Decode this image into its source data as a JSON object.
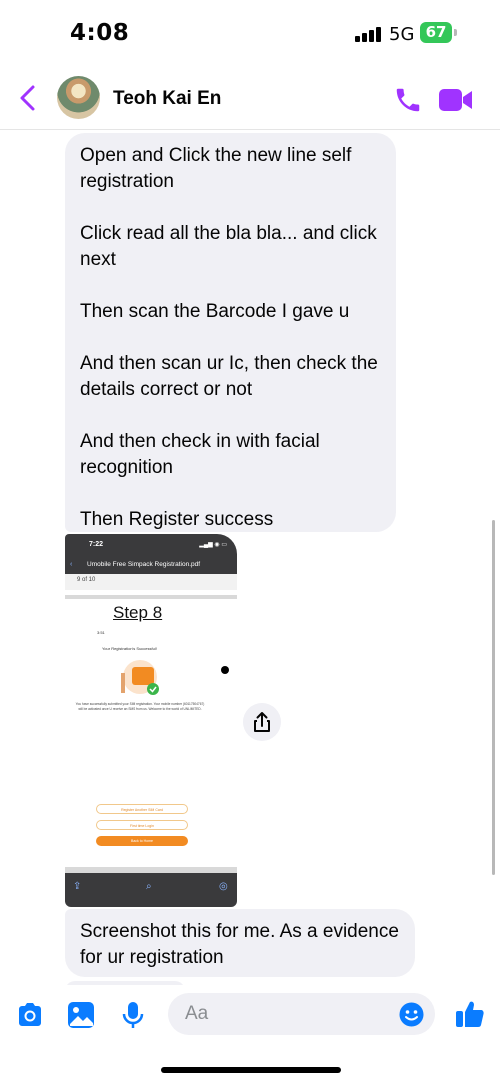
{
  "status_bar": {
    "time": "4:08",
    "network": "5G",
    "battery": "67"
  },
  "header": {
    "contact_name": "Teoh Kai En",
    "accent_color": "#a033ff",
    "icons": [
      "back-chevron-icon",
      "phone-icon",
      "video-camera-icon"
    ]
  },
  "messages": {
    "bubble_1": "Open and Click the new line self registration\n\nClick read all the bla bla... and click next\n\nThen scan the Barcode I gave u\n\nAnd then scan ur Ic, then check the details correct or not\n\nAnd then check in with facial recognition\n\nThen Register success",
    "bubble_2": "Screenshot this for me. As a evidence for ur registration"
  },
  "shared_image": {
    "time": "7:22",
    "file_title": "Umobile Free Simpack Registration.pdf",
    "page_label": "9 of 10",
    "step_title": "Step 8",
    "inner_time": "3:51",
    "success_title": "Your Registration's Successful!",
    "success_text": "You have successfully submitted your SIM registration. Your mobile number (60117504767) will be activated once U receive an SMS from us. Welcome to the world of UNLIMITED.",
    "button_1": "Register Another SIM Card",
    "button_2": "First time Login",
    "button_3": "Back to Home"
  },
  "composer": {
    "placeholder": "Aa",
    "icons": [
      "camera-icon",
      "gallery-icon",
      "microphone-icon",
      "emoji-icon",
      "thumbs-up-icon"
    ]
  }
}
